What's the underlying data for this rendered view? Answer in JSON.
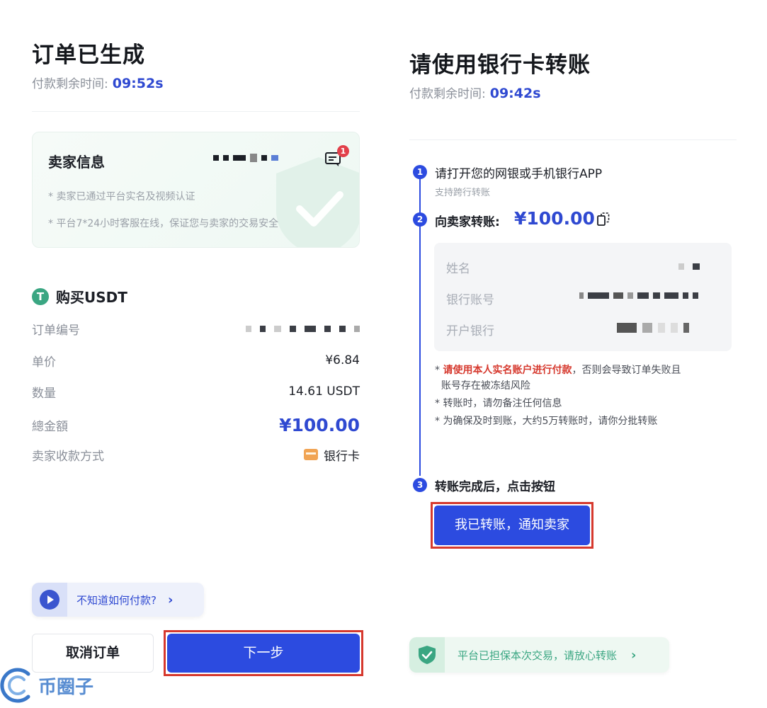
{
  "left": {
    "title": "订单已生成",
    "timer_label": "付款剩余时间:",
    "timer_value": "09:52s",
    "seller_card": {
      "title": "卖家信息",
      "notes": [
        "* 卖家已通过平台实名及视频认证",
        "* 平台7*24小时客服在线，保证您与卖家的交易安全"
      ],
      "badge_count": "1"
    },
    "buy_label": "购买USDT",
    "rows": [
      {
        "key": "订单编号",
        "value": ""
      },
      {
        "key": "单价",
        "value": "¥6.84"
      },
      {
        "key": "数量",
        "value": "14.61 USDT"
      },
      {
        "key": "總金額",
        "value": "¥100.00"
      },
      {
        "key": "卖家收款方式",
        "value": "银行卡"
      }
    ],
    "help_label": "不知道如何付款?",
    "cancel_label": "取消订单",
    "next_label": "下一步"
  },
  "right": {
    "title": "请使用银行卡转账",
    "timer_label": "付款剩余时间:",
    "timer_value": "09:42s",
    "steps": [
      {
        "num": "1",
        "title": "请打开您的网银或手机银行APP",
        "sub": "支持跨行转账"
      },
      {
        "num": "2",
        "title": "向卖家转账:",
        "amount": "¥100.00"
      },
      {
        "num": "3",
        "title": "转账完成后，点击按钮"
      }
    ],
    "bank_fields": [
      "姓名",
      "银行账号",
      "开户银行"
    ],
    "warnings": {
      "w1_red": "请使用本人实名账户进行付款",
      "w1_rest": "，否则会导致订单失败且",
      "w1_line2": "账号存在被冻结风险",
      "w2": "* 转账时，请勿备注任何信息",
      "w3": "* 为确保及时到账，大约5万转账时，请你分批转账"
    },
    "notify_label": "我已转账，通知卖家",
    "assure_label": "平台已担保本次交易，请放心转账"
  },
  "watermark": "币圈子",
  "colors": {
    "accent": "#2c4be0",
    "highlight_frame": "#d6392e",
    "green": "#3aa682"
  }
}
